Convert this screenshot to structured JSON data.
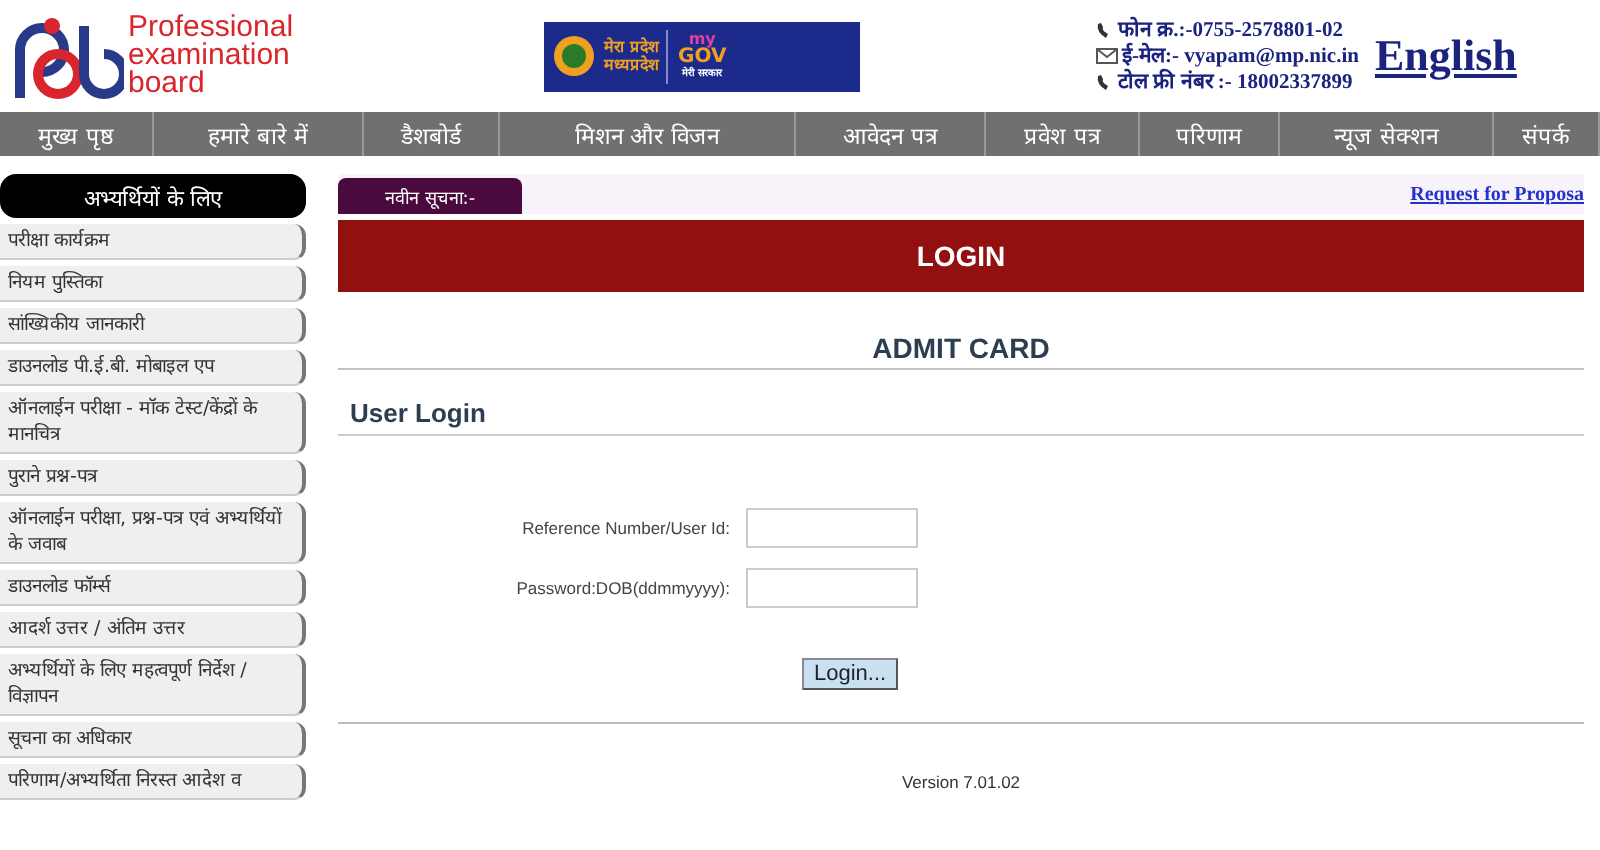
{
  "header": {
    "logo_text": [
      "Professional",
      "examination",
      "board"
    ],
    "banner": {
      "line1": "मेरा प्रदेश",
      "line2": "मध्यप्रदेश",
      "brand_top": "my",
      "brand_main": "GOV",
      "brand_sub": "मेरी सरकार"
    },
    "contacts": [
      {
        "kind": "phone",
        "text": "फोन क्र.:-0755-2578801-02"
      },
      {
        "kind": "mail",
        "text": "ई-मेल:- vyapam@mp.nic.in"
      },
      {
        "kind": "phone",
        "text": "टोल फ्री नंबर :- 18002337899"
      }
    ],
    "language_link": "English"
  },
  "nav": [
    "मुख्य पृष्ठ",
    "हमारे बारे में",
    "डैशबोर्ड",
    "मिशन और विजन",
    "आवेदन पत्र",
    "प्रवेश पत्र",
    "परिणाम",
    "न्यूज सेक्शन",
    "संपर्क"
  ],
  "sidebar": {
    "title": "अभ्यर्थियों के लिए",
    "items": [
      "परीक्षा कार्यक्रम",
      "नियम पुस्तिका",
      "सांख्यिकीय जानकारी",
      "डाउनलोड पी.ई.बी. मोबाइल एप",
      "ऑनलाईन परीक्षा - मॉक टेस्ट/केंद्रों के मानचित्र",
      "पुराने प्रश्न-पत्र",
      "ऑनलाईन परीक्षा, प्रश्न-पत्र एवं अभ्यर्थियों के जवाब",
      "डाउनलोड फॉर्म्स",
      "आदर्श उत्तर / अंतिम उत्तर",
      "अभ्यर्थियों के लिए महत्वपूर्ण निर्देश / विज्ञापन",
      "सूचना का अधिकार",
      "परिणाम/अभ्यर्थिता निरस्त आदेश व"
    ]
  },
  "notice": {
    "label": "नवीन सूचना:-",
    "link": "Request for Proposa"
  },
  "login_bar": "LOGIN",
  "section_title": "ADMIT CARD",
  "form": {
    "title": "User Login",
    "fields": [
      {
        "label": "Reference Number/User Id:"
      },
      {
        "label": "Password:DOB(ddmmyyyy):"
      }
    ],
    "button": "Login..."
  },
  "version": "Version 7.01.02"
}
